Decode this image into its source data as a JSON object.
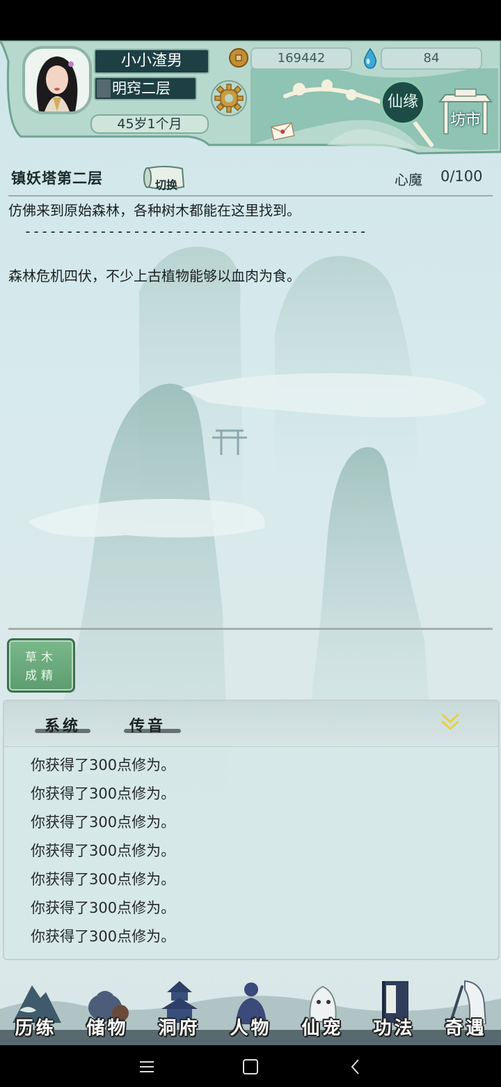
{
  "player": {
    "name": "小小渣男",
    "realm": "明窍二层",
    "age": "45岁1个月"
  },
  "currency": {
    "coins": "169442",
    "spirit_stones": "84"
  },
  "buttons": {
    "xianyuan": "仙缘",
    "fangshi": "坊市",
    "switch": "切换",
    "skill": "草木成精"
  },
  "tower": {
    "title": "镇妖塔第二层",
    "xinmo_label": "心魔",
    "xinmo_value": "0/100"
  },
  "story": {
    "line1": "仿佛来到原始森林，各种树木都能在这里找到。",
    "divider": "-----------------------------------------",
    "line2": "森林危机四伏，不少上古植物能够以血肉为食。"
  },
  "chat": {
    "tabs": [
      "系统",
      "传音"
    ],
    "messages": [
      "你获得了300点修为。",
      "你获得了300点修为。",
      "你获得了300点修为。",
      "你获得了300点修为。",
      "你获得了300点修为。",
      "你获得了300点修为。",
      "你获得了300点修为。"
    ]
  },
  "nav": {
    "items": [
      "历练",
      "储物",
      "洞府",
      "人物",
      "仙宠",
      "功法",
      "奇遇"
    ]
  },
  "icons": {
    "settings": "gear-icon",
    "coin": "copper-coin-icon",
    "stone": "spirit-drop-icon",
    "mail": "envelope-icon",
    "collapse": "double-chevron-down-icon"
  },
  "colors": {
    "accent_green": "#5c9c6f",
    "panel_dark": "#1e3f44",
    "collapse_yellow": "#e5d240"
  }
}
